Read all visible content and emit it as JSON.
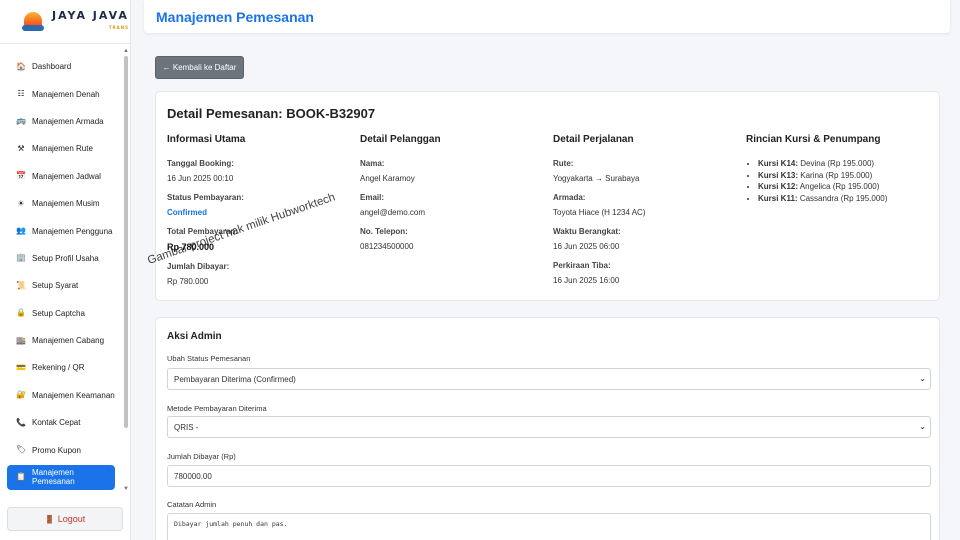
{
  "brand": {
    "name": "JAYA JAVA",
    "tagline": "TRANS"
  },
  "sidebar": {
    "items": [
      {
        "icon": "home-icon",
        "glyph": "🏠",
        "label": "Dashboard"
      },
      {
        "icon": "list-icon",
        "glyph": "☷",
        "label": "Manajemen Denah"
      },
      {
        "icon": "bus-icon",
        "glyph": "🚌",
        "label": "Manajemen Armada"
      },
      {
        "icon": "tools-icon",
        "glyph": "⚒",
        "label": "Manajemen Rute"
      },
      {
        "icon": "calendar-icon",
        "glyph": "📅",
        "label": "Manajemen Jadwal"
      },
      {
        "icon": "season-icon",
        "glyph": "☀",
        "label": "Manajemen Musim"
      },
      {
        "icon": "users-icon",
        "glyph": "👥",
        "label": "Manajemen Pengguna"
      },
      {
        "icon": "building-icon",
        "glyph": "🏢",
        "label": "Setup Profil Usaha"
      },
      {
        "icon": "scroll-icon",
        "glyph": "📜",
        "label": "Setup Syarat"
      },
      {
        "icon": "lock-icon",
        "glyph": "🔒",
        "label": "Setup Captcha"
      },
      {
        "icon": "branch-icon",
        "glyph": "🏬",
        "label": "Manajemen Cabang"
      },
      {
        "icon": "card-icon",
        "glyph": "💳",
        "label": "Rekening / QR"
      },
      {
        "icon": "security-icon",
        "glyph": "🔐",
        "label": "Manajemen Keamanan"
      },
      {
        "icon": "phone-icon",
        "glyph": "📞",
        "label": "Kontak Cepat"
      },
      {
        "icon": "tag-icon",
        "glyph": "🏷",
        "label": "Promo Kupon"
      },
      {
        "icon": "clipboard-icon",
        "glyph": "📋",
        "label": "Manajemen Pemesanan"
      }
    ],
    "logout_label": "Logout",
    "logout_glyph": "🚪"
  },
  "header": {
    "title": "Manajemen Pemesanan"
  },
  "back_button": "← Kembali ke Daftar",
  "detail": {
    "title": "Detail Pemesanan: BOOK-B32907",
    "info": {
      "heading": "Informasi Utama",
      "booking_label": "Tanggal Booking:",
      "booking_value": "16 Jun 2025 00:10",
      "status_label": "Status Pembayaran:",
      "status_value": "Confirmed",
      "total_label": "Total Pembayaran:",
      "total_value": "Rp 780.000",
      "paid_label": "Jumlah Dibayar:",
      "paid_value": "Rp 780.000"
    },
    "customer": {
      "heading": "Detail Pelanggan",
      "name_label": "Nama:",
      "name_value": "Angel Karamoy",
      "email_label": "Email:",
      "email_value": "angel@demo.com",
      "phone_label": "No. Telepon:",
      "phone_value": "081234500000"
    },
    "trip": {
      "heading": "Detail Perjalanan",
      "route_label": "Rute:",
      "route_value": "Yogyakarta → Surabaya",
      "fleet_label": "Armada:",
      "fleet_value": "Toyota Hiace (H 1234 AC)",
      "depart_label": "Waktu Berangkat:",
      "depart_value": "16 Jun 2025 06:00",
      "arrive_label": "Perkiraan Tiba:",
      "arrive_value": "16 Jun 2025 16:00"
    },
    "seats": {
      "heading": "Rincian Kursi & Penumpang",
      "items": [
        {
          "seat": "Kursi K14:",
          "passenger": "Devina (Rp 195.000)"
        },
        {
          "seat": "Kursi K13:",
          "passenger": "Karina (Rp 195.000)"
        },
        {
          "seat": "Kursi K12:",
          "passenger": "Angelica (Rp 195.000)"
        },
        {
          "seat": "Kursi K11:",
          "passenger": "Cassandra (Rp 195.000)"
        }
      ]
    }
  },
  "watermark": "Gambar project hak milik Hubworktech",
  "admin": {
    "title": "Aksi Admin",
    "status_label": "Ubah Status Pemesanan",
    "status_value": "Pembayaran Diterima (Confirmed)",
    "method_label": "Metode Pembayaran Diterima",
    "method_value": "QRIS -",
    "amount_label": "Jumlah Dibayar (Rp)",
    "amount_value": "780000.00",
    "notes_label": "Catatan Admin",
    "notes_value": "Dibayar jumlah penuh dan pas."
  }
}
